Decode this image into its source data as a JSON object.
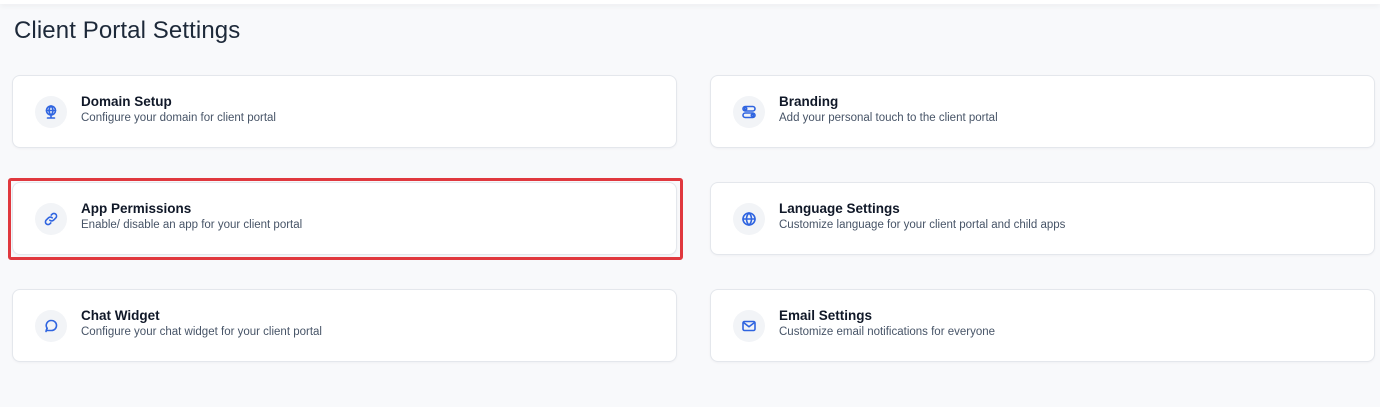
{
  "page": {
    "title": "Client Portal Settings"
  },
  "cards": [
    {
      "icon": "globe-pin-icon",
      "title": "Domain Setup",
      "description": "Configure your domain for client portal"
    },
    {
      "icon": "toggle-icon",
      "title": "Branding",
      "description": "Add your personal touch to the client portal"
    },
    {
      "icon": "link-icon",
      "title": "App Permissions",
      "description": "Enable/ disable an app for your client portal"
    },
    {
      "icon": "globe-icon",
      "title": "Language Settings",
      "description": "Customize language for your client portal and child apps"
    },
    {
      "icon": "chat-bubble-icon",
      "title": "Chat Widget",
      "description": "Configure your chat widget for your client portal"
    },
    {
      "icon": "mail-icon",
      "title": "Email Settings",
      "description": "Customize email notifications for everyone"
    }
  ],
  "colors": {
    "accent": "#2f64e0",
    "highlight": "#e0383e",
    "background": "#f8f9fb"
  }
}
